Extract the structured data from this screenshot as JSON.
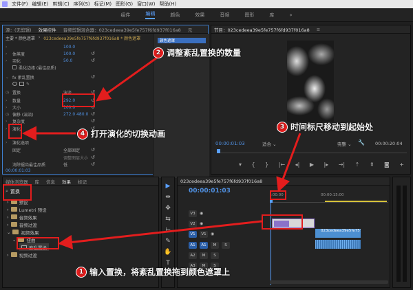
{
  "menubar": {
    "items": [
      "文件(F)",
      "编辑(E)",
      "剪辑(C)",
      "序列(S)",
      "标记(M)",
      "图形(G)",
      "窗口(W)",
      "帮助(H)"
    ]
  },
  "workspaces": {
    "items": [
      "组件",
      "编辑",
      "颜色",
      "效果",
      "音频",
      "图形",
      "库"
    ],
    "active": "编辑",
    "more": "»"
  },
  "effect_controls": {
    "tabs": [
      "源：(无剪辑)",
      "效果控件",
      "音频剪辑混合器：023cedeea39e5fe757f6fd937f016a8",
      "元"
    ],
    "clip_path": "主要 * 颜色遮罩",
    "clip_path_sep": "›",
    "clip_path_seq": "023cedeea39e5fe757f6fd937f016a8 * 颜色遮罩",
    "rows": [
      {
        "label": "",
        "value": "100.0"
      },
      {
        "label": "体蒸度",
        "value": "100.0"
      },
      {
        "label": "羽化",
        "value": "50.0"
      },
      {
        "label": "柔化边缘 (最佳品质)",
        "value": ""
      },
      {
        "label": "fx 紊乱置换",
        "value": ""
      },
      {
        "label": "",
        "value": ""
      },
      {
        "label": "置换",
        "value": "湍流"
      },
      {
        "label": "数量",
        "value": "292.0"
      },
      {
        "label": "大小",
        "value": "100.0"
      },
      {
        "label": "偏移 (湍流)",
        "value": "272.0   480.0"
      },
      {
        "label": "复杂度",
        "value": ""
      },
      {
        "label": "演化",
        "value": ""
      },
      {
        "label": "演化选项",
        "value": ""
      },
      {
        "label": "固定",
        "value": "全部固定"
      },
      {
        "label": "调整图层大小",
        "value": ""
      },
      {
        "label": "消除锯齿最佳品质",
        "value": "低"
      }
    ],
    "timecode": "00:00:01:03",
    "right_clip": "颜色遮罩"
  },
  "program": {
    "title": "节目：023cedeea39e5fe757f6fd937f016a8",
    "menu_glyph": "≡",
    "timecode": "00:00:01:03",
    "fit": "适合",
    "quality": "完整",
    "duration": "00:00:20:04"
  },
  "project": {
    "tabs": [
      "媒体浏览器",
      "库",
      "信息",
      "效果",
      "标记"
    ],
    "search_value": "置换",
    "tree": [
      {
        "label": "预设",
        "indent": 0
      },
      {
        "label": "Lumetri 预设",
        "indent": 0
      },
      {
        "label": "音频效果",
        "indent": 0
      },
      {
        "label": "音频过渡",
        "indent": 0
      },
      {
        "label": "视频效果",
        "indent": 0
      },
      {
        "label": "扭曲",
        "indent": 1
      },
      {
        "label": "紊乱置换",
        "indent": 2
      },
      {
        "label": "视频过渡",
        "indent": 0
      }
    ]
  },
  "timeline": {
    "tab": "023cedeea39e5fe757f6fd937f016a8",
    "timecode": "00:00:01:03",
    "ruler": [
      ":00:00",
      "00:00:15:00"
    ],
    "tracks": [
      "V3",
      "V2",
      "V1",
      "A1",
      "A2",
      "A3"
    ],
    "track_flags": [
      "M",
      "S"
    ],
    "clip_v2": "",
    "clip_v1": "023cedeea39e5fe757f6fd937f016a8",
    "tools": [
      "▶",
      "⇹",
      "✥",
      "⇆",
      "⊢",
      "✎",
      "✋",
      "T"
    ]
  },
  "annotations": [
    {
      "num": "1",
      "text": "输入置换，将紊乱置换拖到颜色遮罩上"
    },
    {
      "num": "2",
      "text": "调整紊乱置换的数量"
    },
    {
      "num": "3",
      "text": "时间标尺移动到起始处"
    },
    {
      "num": "4",
      "text": "打开演化的切换动画"
    }
  ],
  "colors": {
    "accent": "#3e7fd0",
    "callout": "#e31d1d",
    "timecode": "#4f8fe0"
  }
}
